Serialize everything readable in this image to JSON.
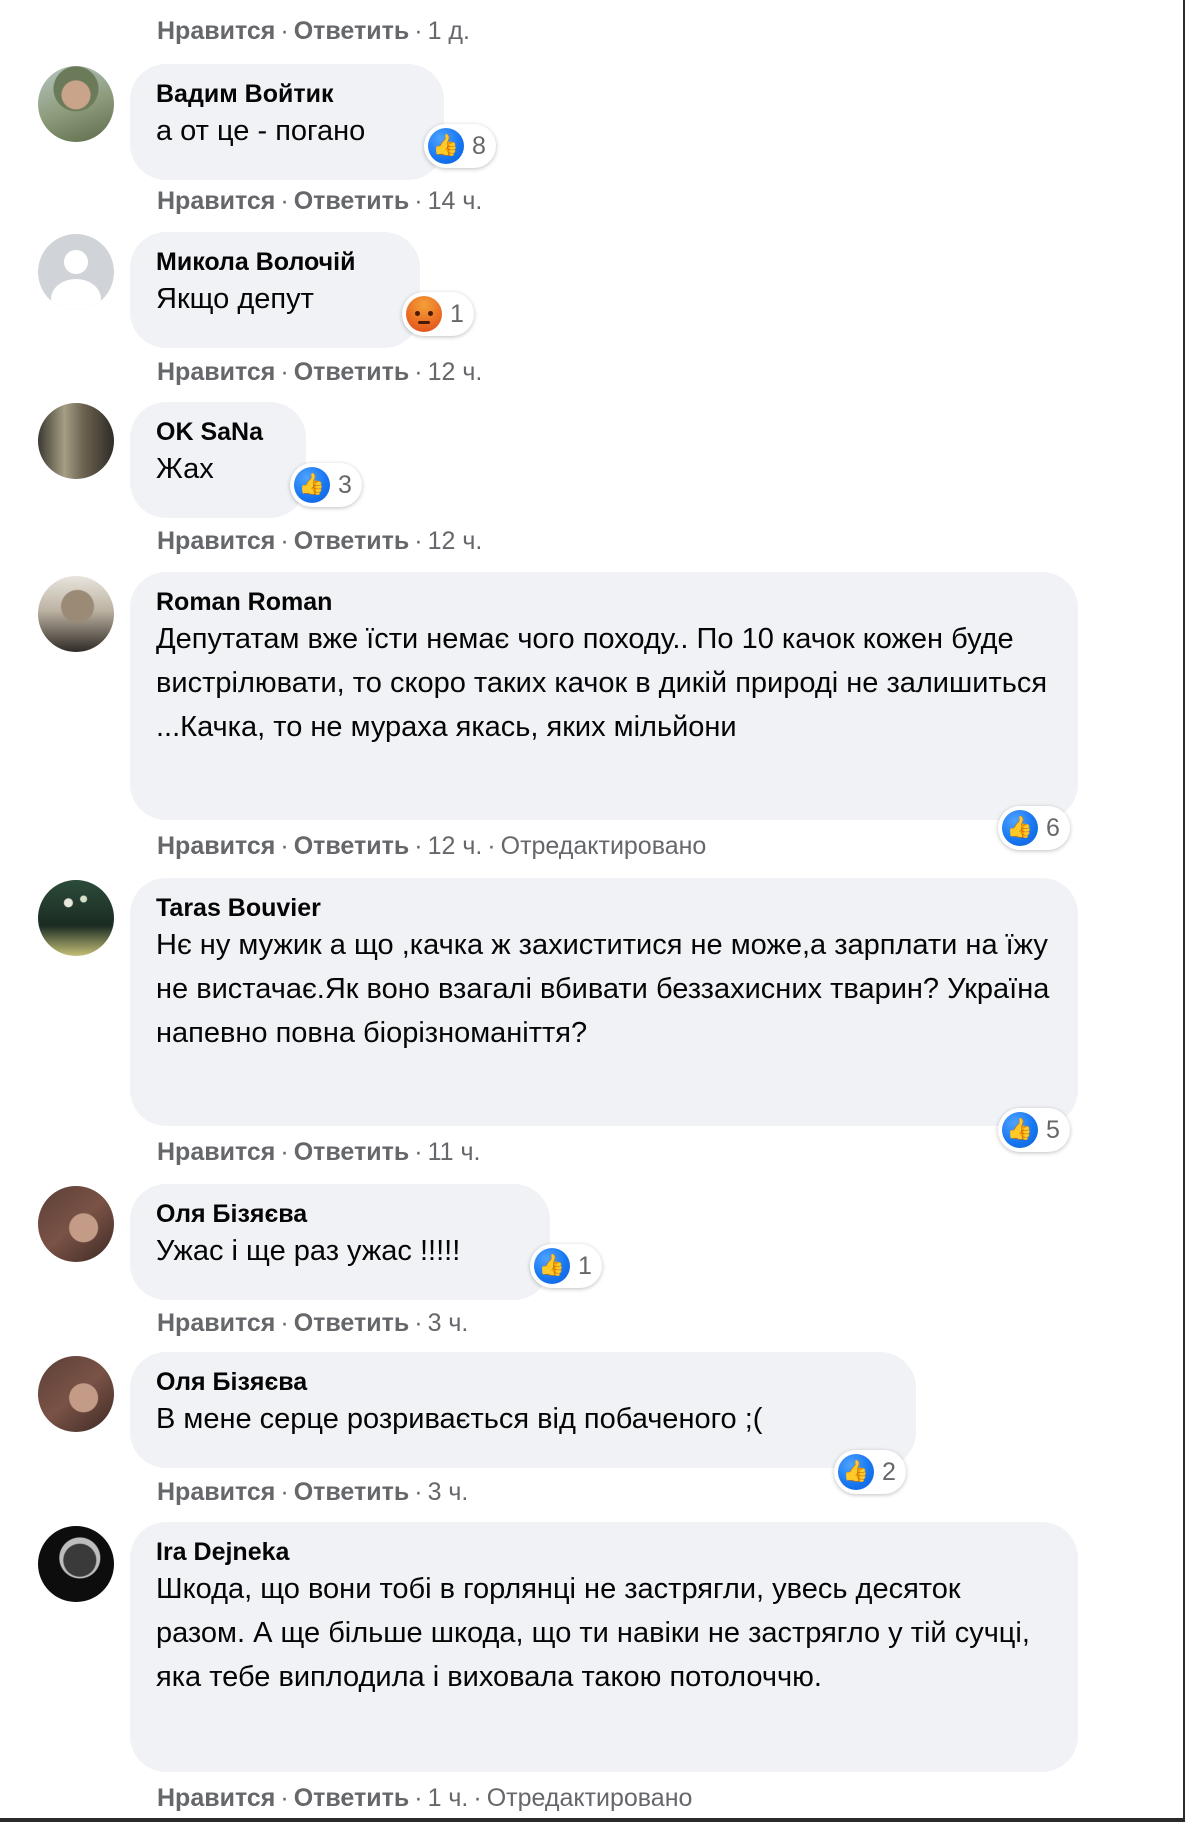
{
  "top_meta": {
    "like": "Нравится",
    "reply": "Ответить",
    "time": "1 д."
  },
  "comments": [
    {
      "author": "Вадим Войтик",
      "text": "а от це - погано",
      "reaction": "like",
      "count": "8",
      "like": "Нравится",
      "reply": "Ответить",
      "time": "14 ч.",
      "edited": ""
    },
    {
      "author": "Микола Волочій",
      "text": "Якщо депут",
      "reaction": "angry",
      "count": "1",
      "like": "Нравится",
      "reply": "Ответить",
      "time": "12 ч.",
      "edited": ""
    },
    {
      "author": "OK SaNa",
      "text": "Жах",
      "reaction": "like",
      "count": "3",
      "like": "Нравится",
      "reply": "Ответить",
      "time": "12 ч.",
      "edited": ""
    },
    {
      "author": "Roman Roman",
      "text": "Депутатам вже їсти немає чого походу.. По 10 качок кожен буде вистрілювати, то скоро таких качок в дикій природі не залишиться ...Качка, то не мураха якась, яких мільйони",
      "reaction": "like",
      "count": "6",
      "like": "Нравится",
      "reply": "Ответить",
      "time": "12 ч.",
      "edited": "Отредактировано"
    },
    {
      "author": "Taras Bouvier",
      "text": "Нє ну мужик а що ,качка ж захиститися не може,а зарплати на їжу не вистачає.Як воно взагалі вбивати беззахисних тварин? Україна напевно повна біорізноманіття?",
      "reaction": "like",
      "count": "5",
      "like": "Нравится",
      "reply": "Ответить",
      "time": "11 ч.",
      "edited": ""
    },
    {
      "author": "Оля Бізяєва",
      "text": "Ужас і ще раз ужас !!!!!",
      "reaction": "like",
      "count": "1",
      "like": "Нравится",
      "reply": "Ответить",
      "time": "3 ч.",
      "edited": ""
    },
    {
      "author": "Оля Бізяєва",
      "text": "В мене серце розривається від побаченого ;(",
      "reaction": "like",
      "count": "2",
      "like": "Нравится",
      "reply": "Ответить",
      "time": "3 ч.",
      "edited": ""
    },
    {
      "author": "Ira Dejneka",
      "text": "Шкода, що вони тобі в горлянці не застрягли, увесь десяток разом. А ще більше шкода, що ти навіки не застрягло у тій сучці, яка тебе виплодила і виховала такою потолоччю.",
      "reaction": "",
      "count": "",
      "like": "Нравится",
      "reply": "Ответить",
      "time": "1 ч.",
      "edited": "Отредактировано"
    }
  ],
  "colors": {
    "bubble": "#f0f2f5",
    "meta": "#65676b",
    "like_blue": "#1877f2",
    "angry": "#ea6b22"
  },
  "icons": {
    "like": "like-icon",
    "angry": "angry-icon"
  }
}
